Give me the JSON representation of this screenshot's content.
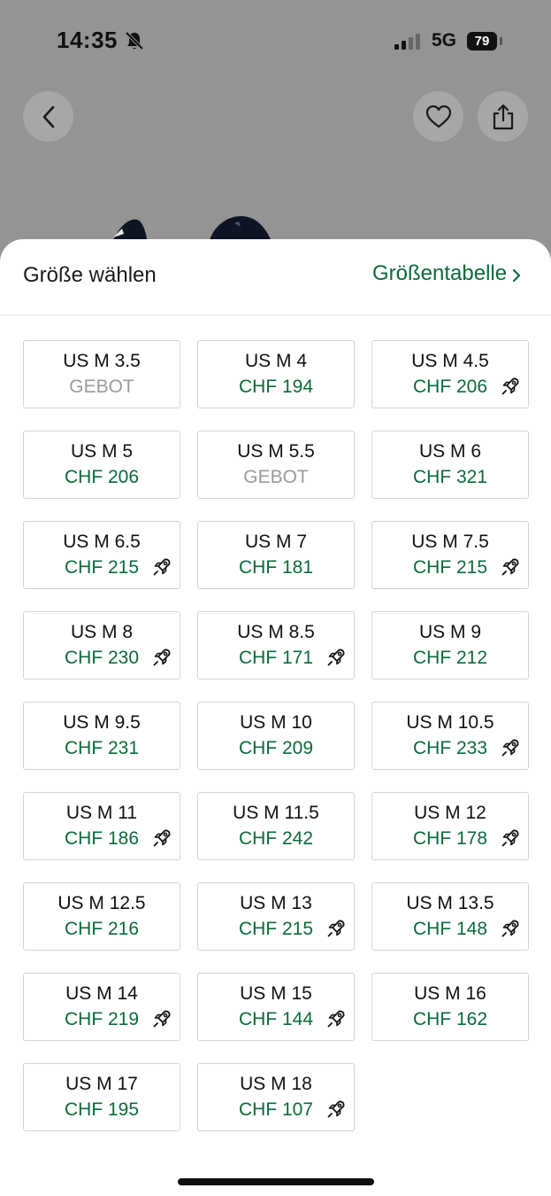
{
  "status_bar": {
    "time": "14:35",
    "network": "5G",
    "battery": "79"
  },
  "sheet": {
    "title": "Größe wählen",
    "size_chart_link": "Größentabelle"
  },
  "colors": {
    "accent": "#0b6b3a",
    "muted": "#9a9a9a"
  },
  "sizes": [
    {
      "size": "US M 3.5",
      "price": "GEBOT",
      "bid": true,
      "express": false
    },
    {
      "size": "US M 4",
      "price": "CHF 194",
      "bid": false,
      "express": false
    },
    {
      "size": "US M 4.5",
      "price": "CHF 206",
      "bid": false,
      "express": true
    },
    {
      "size": "US M 5",
      "price": "CHF 206",
      "bid": false,
      "express": false
    },
    {
      "size": "US M 5.5",
      "price": "GEBOT",
      "bid": true,
      "express": false
    },
    {
      "size": "US M 6",
      "price": "CHF 321",
      "bid": false,
      "express": false
    },
    {
      "size": "US M 6.5",
      "price": "CHF 215",
      "bid": false,
      "express": true
    },
    {
      "size": "US M 7",
      "price": "CHF 181",
      "bid": false,
      "express": false
    },
    {
      "size": "US M 7.5",
      "price": "CHF 215",
      "bid": false,
      "express": true
    },
    {
      "size": "US M 8",
      "price": "CHF 230",
      "bid": false,
      "express": true
    },
    {
      "size": "US M 8.5",
      "price": "CHF 171",
      "bid": false,
      "express": true
    },
    {
      "size": "US M 9",
      "price": "CHF 212",
      "bid": false,
      "express": false
    },
    {
      "size": "US M 9.5",
      "price": "CHF 231",
      "bid": false,
      "express": false
    },
    {
      "size": "US M 10",
      "price": "CHF 209",
      "bid": false,
      "express": false
    },
    {
      "size": "US M 10.5",
      "price": "CHF 233",
      "bid": false,
      "express": true
    },
    {
      "size": "US M 11",
      "price": "CHF 186",
      "bid": false,
      "express": true
    },
    {
      "size": "US M 11.5",
      "price": "CHF 242",
      "bid": false,
      "express": false
    },
    {
      "size": "US M 12",
      "price": "CHF 178",
      "bid": false,
      "express": true
    },
    {
      "size": "US M 12.5",
      "price": "CHF 216",
      "bid": false,
      "express": false
    },
    {
      "size": "US M 13",
      "price": "CHF 215",
      "bid": false,
      "express": true
    },
    {
      "size": "US M 13.5",
      "price": "CHF 148",
      "bid": false,
      "express": true
    },
    {
      "size": "US M 14",
      "price": "CHF 219",
      "bid": false,
      "express": true
    },
    {
      "size": "US M 15",
      "price": "CHF 144",
      "bid": false,
      "express": true
    },
    {
      "size": "US M 16",
      "price": "CHF 162",
      "bid": false,
      "express": false
    },
    {
      "size": "US M 17",
      "price": "CHF 195",
      "bid": false,
      "express": false
    },
    {
      "size": "US M 18",
      "price": "CHF 107",
      "bid": false,
      "express": true
    }
  ]
}
